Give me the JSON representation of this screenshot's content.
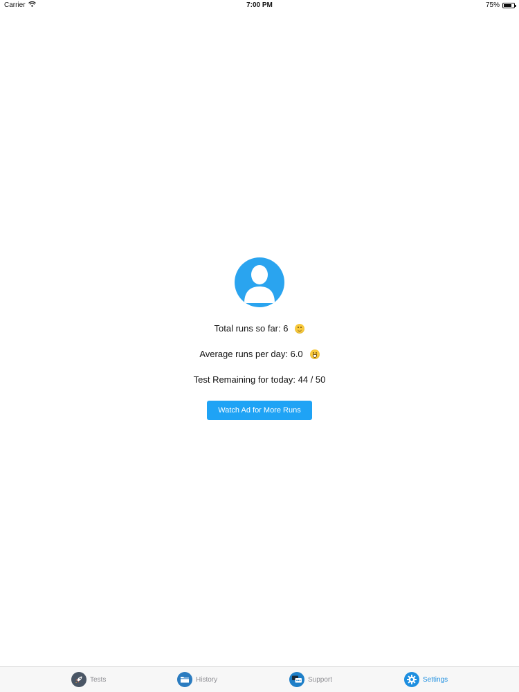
{
  "status_bar": {
    "carrier": "Carrier",
    "time": "7:00 PM",
    "battery": "75%",
    "battery_level": 0.75
  },
  "profile": {
    "avatar_icon": "user-avatar-icon",
    "avatar_color": "#2aa4ef"
  },
  "stats": {
    "total_runs": "Total runs so far: 6",
    "average_runs": "Average runs per day: 6.0",
    "remaining": "Test Remaining for today: 44 / 50"
  },
  "actions": {
    "watch_ad_label": "Watch Ad for More Runs",
    "button_color": "#1fa3f5"
  },
  "tab_bar": {
    "active": "Settings",
    "items": [
      {
        "label": "Tests",
        "icon": "rocket-icon"
      },
      {
        "label": "History",
        "icon": "folder-icon"
      },
      {
        "label": "Support",
        "icon": "chat-bubbles-icon"
      },
      {
        "label": "Settings",
        "icon": "gear-icon"
      }
    ],
    "active_color": "#1e8fe0"
  }
}
